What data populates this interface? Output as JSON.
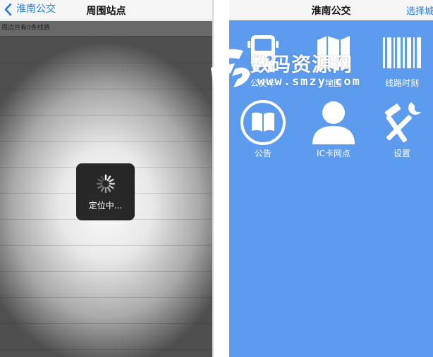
{
  "left": {
    "nav": {
      "back_label": "淮南公交",
      "title": "周围站点"
    },
    "info_text": "周边共有0条线路",
    "loading_text": "定位中..."
  },
  "right": {
    "nav": {
      "title": "淮南公交",
      "city_button": "选择城市"
    },
    "menu": [
      {
        "label": "公交车",
        "icon": "bus-icon"
      },
      {
        "label": "地图",
        "icon": "map-icon"
      },
      {
        "label": "线路时刻",
        "icon": "barcode-icon"
      },
      {
        "label": "公告",
        "icon": "book-icon"
      },
      {
        "label": "IC卡网点",
        "icon": "person-icon"
      },
      {
        "label": "设置",
        "icon": "tools-icon"
      }
    ]
  },
  "watermark": {
    "text": "数码资源网",
    "url": "www.smzy.com"
  },
  "colors": {
    "accent": "#1a7cf2",
    "home_background": "#5c9bee",
    "nav_background": "#f6f6f7",
    "hud_background": "#161616"
  }
}
